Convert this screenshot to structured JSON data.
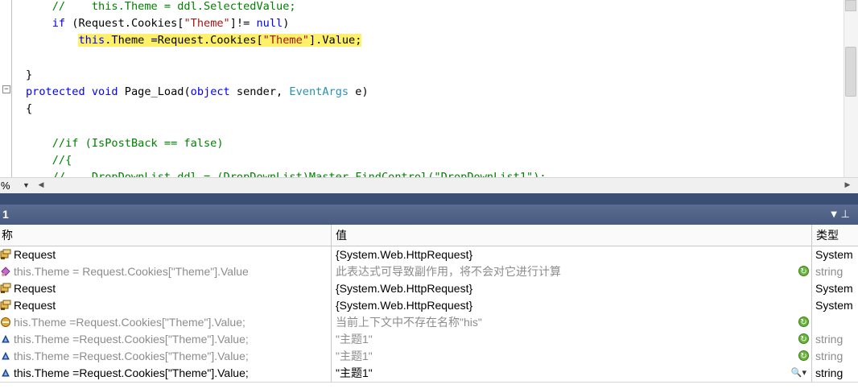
{
  "editor": {
    "lines": [
      {
        "indent": "    ",
        "parts": [
          {
            "t": "//    this.Theme = ddl.SelectedValue;",
            "c": "cm"
          }
        ]
      },
      {
        "indent": "    ",
        "parts": [
          {
            "t": "if",
            "c": "kw"
          },
          {
            "t": " (Request.Cookies[",
            "c": ""
          },
          {
            "t": "\"Theme\"",
            "c": "str"
          },
          {
            "t": "]!= ",
            "c": ""
          },
          {
            "t": "null",
            "c": "kw"
          },
          {
            "t": ")",
            "c": ""
          }
        ]
      },
      {
        "indent": "        ",
        "parts": [
          {
            "t": "this",
            "c": "kw hl"
          },
          {
            "t": ".Theme =Request.Cookies[",
            "c": "hl"
          },
          {
            "t": "\"Theme\"",
            "c": "str hl"
          },
          {
            "t": "].Value;",
            "c": "hl"
          }
        ]
      },
      {
        "indent": "",
        "parts": []
      },
      {
        "indent": "",
        "parts": [
          {
            "t": "}",
            "c": ""
          }
        ]
      },
      {
        "indent": "",
        "parts": [
          {
            "t": "protected",
            "c": "kw"
          },
          {
            "t": " ",
            "c": ""
          },
          {
            "t": "void",
            "c": "kw"
          },
          {
            "t": " Page_Load(",
            "c": ""
          },
          {
            "t": "object",
            "c": "kw"
          },
          {
            "t": " sender, ",
            "c": ""
          },
          {
            "t": "EventArgs",
            "c": "ty"
          },
          {
            "t": " e)",
            "c": ""
          }
        ]
      },
      {
        "indent": "",
        "parts": [
          {
            "t": "{",
            "c": ""
          }
        ]
      },
      {
        "indent": "",
        "parts": []
      },
      {
        "indent": "    ",
        "parts": [
          {
            "t": "//if (IsPostBack == false)",
            "c": "cm"
          }
        ]
      },
      {
        "indent": "    ",
        "parts": [
          {
            "t": "//{",
            "c": "cm"
          }
        ]
      },
      {
        "indent": "    ",
        "parts": [
          {
            "t": "//    DropDownList ddl = (DropDownList)Master.FindControl(\"DropDownList1\");",
            "c": "cm"
          }
        ]
      }
    ]
  },
  "zoom": {
    "value": "%",
    "arrow": "▼",
    "left_arrow": "◀",
    "right_arrow": "▶"
  },
  "watch": {
    "title": "1",
    "headers": {
      "name": "称",
      "value": "值",
      "type": "类型"
    },
    "rows": [
      {
        "icon": "object-icon",
        "name": "Request",
        "value": "{System.Web.HttpRequest}",
        "type": "System",
        "style": "black",
        "refresh": false,
        "magnify": false
      },
      {
        "icon": "side-effect-icon",
        "name": "this.Theme = Request.Cookies[\"Theme\"].Value",
        "value": "此表达式可导致副作用，将不会对它进行计算",
        "type": "string",
        "style": "gray",
        "refresh": true,
        "magnify": false
      },
      {
        "icon": "object-icon",
        "name": "Request",
        "value": "{System.Web.HttpRequest}",
        "type": "System",
        "style": "black",
        "refresh": false,
        "magnify": false
      },
      {
        "icon": "object-icon",
        "name": "Request",
        "value": "{System.Web.HttpRequest}",
        "type": "System",
        "style": "black",
        "refresh": false,
        "magnify": false
      },
      {
        "icon": "error-icon",
        "name": "his.Theme =Request.Cookies[\"Theme\"].Value;",
        "value": "当前上下文中不存在名称\"his\"",
        "type": "",
        "style": "gray",
        "refresh": true,
        "magnify": false
      },
      {
        "icon": "property-icon",
        "name": "this.Theme =Request.Cookies[\"Theme\"].Value;",
        "value": "\"主题1\"",
        "type": "string",
        "style": "gray",
        "refresh": true,
        "magnify": false
      },
      {
        "icon": "property-icon",
        "name": "this.Theme =Request.Cookies[\"Theme\"].Value;",
        "value": "\"主题1\"",
        "type": "string",
        "style": "gray",
        "refresh": true,
        "magnify": false
      },
      {
        "icon": "property-icon",
        "name": "this.Theme =Request.Cookies[\"Theme\"].Value;",
        "value": "\"主题1\"",
        "type": "string",
        "style": "black",
        "refresh": false,
        "magnify": true
      }
    ]
  },
  "colors": {
    "keyword": "#0000ff",
    "string": "#a31515",
    "comment": "#008000",
    "type": "#2b91af",
    "highlight": "#fff06a",
    "header": "#485b80"
  }
}
